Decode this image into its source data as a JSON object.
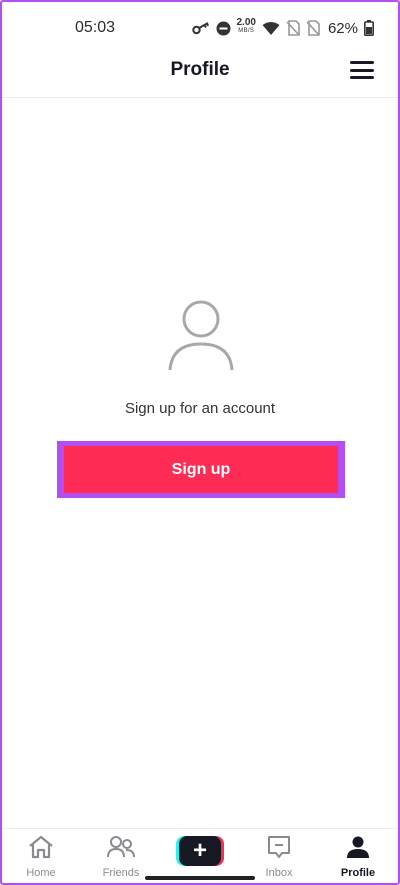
{
  "status_bar": {
    "time": "05:03",
    "net_speed_value": "2.00",
    "net_speed_unit": "MB/S",
    "battery_percent": "62%",
    "icons": [
      "key-icon",
      "do-not-disturb-icon",
      "wifi-icon",
      "no-sim-icon",
      "no-sim-icon",
      "battery-icon"
    ]
  },
  "header": {
    "title": "Profile",
    "menu_icon": "hamburger-menu-icon"
  },
  "main": {
    "avatar_icon": "user-outline-icon",
    "prompt": "Sign up for an account",
    "signup_label": "Sign up"
  },
  "bottom_nav": {
    "items": [
      {
        "label": "Home",
        "icon": "home-icon",
        "active": false
      },
      {
        "label": "Friends",
        "icon": "friends-icon",
        "active": false
      },
      {
        "label": "",
        "icon": "plus-icon",
        "active": false
      },
      {
        "label": "Inbox",
        "icon": "inbox-icon",
        "active": false
      },
      {
        "label": "Profile",
        "icon": "profile-icon",
        "active": true
      }
    ]
  },
  "colors": {
    "accent": "#fe2c55",
    "highlight_border": "#b44ef0",
    "create_cyan": "#25f4ee",
    "text_dark": "#161823",
    "text_muted": "#8a8b91"
  }
}
